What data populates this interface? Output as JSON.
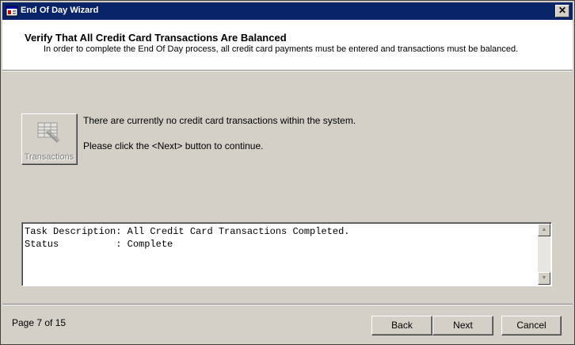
{
  "window": {
    "title": "End Of Day Wizard",
    "close_label": "✕",
    "app_icon": "wizard-app-icon"
  },
  "header": {
    "title": "Verify That All Credit Card Transactions Are Balanced",
    "description": "In order to complete the End Of Day process, all credit card payments must be entered and transactions must be balanced."
  },
  "transactions_button": {
    "label": "Transactions",
    "icon": "credit-card-list-icon",
    "enabled": false
  },
  "messages": {
    "line1": "There are currently no credit card transactions within the system.",
    "line2": "Please click the <Next> button to continue."
  },
  "task_box": {
    "text": "Task Description: All Credit Card Transactions Completed.\nStatus          : Complete"
  },
  "footer": {
    "page_label": "Page 7 of 15",
    "back_label": "Back",
    "next_label": "Next",
    "cancel_label": "Cancel"
  },
  "colors": {
    "titlebar": "#0a246a",
    "dialog_face": "#d4d0c8",
    "header_bg": "#ffffff"
  }
}
